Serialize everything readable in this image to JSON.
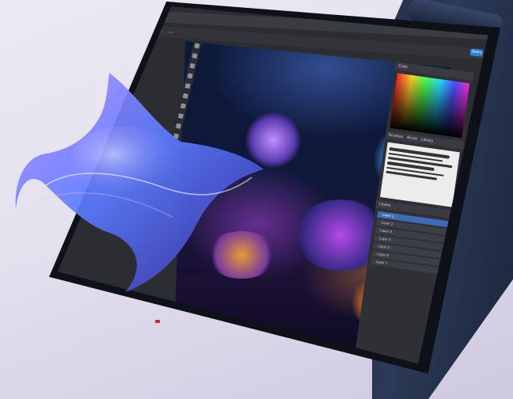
{
  "editor": {
    "share_label": "Share",
    "menu_items": [
      "",
      "",
      "",
      "",
      "",
      "",
      "",
      ""
    ],
    "options": {
      "chips": [
        "",
        ""
      ]
    },
    "panels": {
      "tabs_top": [
        "Color",
        ""
      ],
      "tabs_mid": [
        "Brushes",
        "Brush",
        "Library"
      ],
      "layers_title": "Layers",
      "layers": [
        {
          "name": "Layer 1",
          "active": true
        },
        {
          "name": "Layer 2",
          "active": false
        },
        {
          "name": "Layer 3",
          "active": false
        },
        {
          "name": "Layer 4",
          "active": false
        },
        {
          "name": "Layer 5",
          "active": false
        },
        {
          "name": "Layer 6",
          "active": false
        },
        {
          "name": "Layer 7",
          "active": false
        }
      ]
    }
  },
  "colors": {
    "background": "#e6e2ef",
    "laptop_body": "#23304a",
    "share_button": "#2f7dd6",
    "active_layer": "#3f6ab6",
    "side_button": "#c02a3a"
  },
  "icons": [
    "manta-ray-artwork",
    "coral-reef-artwork"
  ]
}
